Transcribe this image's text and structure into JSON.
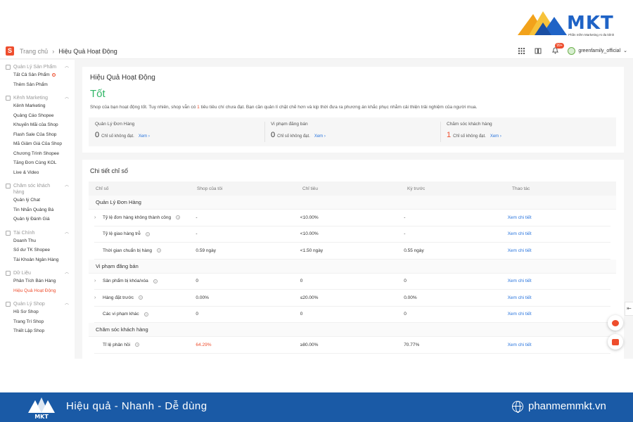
{
  "brand": {
    "name": "MKT",
    "tagline": "Phần mềm Marketing AI đa kênh"
  },
  "colors": {
    "shopee_orange": "#ee4d2d",
    "good_green": "#30b566",
    "link_blue": "#2673dd",
    "banner_blue": "#1a5aa6"
  },
  "topbar": {
    "breadcrumb_home": "Trang chủ",
    "breadcrumb_current": "Hiệu Quả Hoạt Động",
    "icons": [
      "apps-grid-icon",
      "book-icon",
      "bell-icon"
    ],
    "notification_badge": "99+",
    "username": "greenfamily_official"
  },
  "sidebar": {
    "sections": [
      {
        "title": "Quản Lý Sản Phẩm",
        "icon": "box-icon",
        "items": [
          "Tất Cả Sản Phẩm",
          "Thêm Sản Phẩm"
        ]
      },
      {
        "title": "Kênh Marketing",
        "icon": "tag-icon",
        "items": [
          "Kênh Marketing",
          "Quảng Cáo Shopee",
          "Khuyến Mãi của Shop",
          "Flash Sale Của Shop",
          "Mã Giảm Giá Của Shop",
          "Chương Trình Shopee",
          "Tăng Đơn Cùng KOL",
          "Live & Video"
        ]
      },
      {
        "title": "Chăm sóc khách hàng",
        "icon": "chat-icon",
        "items": [
          "Quản lý Chat",
          "Tin Nhắn Quảng Bá",
          "Quản lý Đánh Giá"
        ]
      },
      {
        "title": "Tài Chính",
        "icon": "wallet-icon",
        "items": [
          "Doanh Thu",
          "Số dư TK Shopee",
          "Tài Khoản Ngân Hàng"
        ]
      },
      {
        "title": "Dữ Liệu",
        "icon": "chart-icon",
        "items": [
          "Phân Tích Bán Hàng",
          "Hiệu Quả Hoạt Động"
        ]
      },
      {
        "title": "Quản Lý Shop",
        "icon": "shop-icon",
        "items": [
          "Hồ Sơ Shop",
          "Trang Trí Shop",
          "Thiết Lập Shop"
        ]
      }
    ]
  },
  "overview": {
    "title": "Hiệu Quả Hoạt Động",
    "status": "Tốt",
    "desc_before": "Shop của bạn hoạt động tốt. Tuy nhiên, shop vẫn có ",
    "desc_count": "1",
    "desc_after": " tiêu tiêu chí chưa đạt. Bạn cần quản lí chặt chẽ hơn và kịp thời đưa ra phương án khắc phục nhằm cải thiện trải nghiệm của người mua.",
    "cards": [
      {
        "title": "Quản Lý Đơn Hàng",
        "count": "0",
        "label": "Chỉ số không đạt.",
        "link": "Xem"
      },
      {
        "title": "Vi phạm đăng bán",
        "count": "0",
        "label": "Chỉ số không đạt.",
        "link": "Xem"
      },
      {
        "title": "Chăm sóc khách hàng",
        "count": "1",
        "label": "Chỉ số không đạt.",
        "link": "Xem"
      }
    ]
  },
  "detail": {
    "title": "Chi tiết chỉ số",
    "headers": [
      "Chỉ số",
      "Shop của tôi",
      "Chỉ tiêu",
      "Kỳ trước",
      "Thao tác"
    ],
    "groups": [
      {
        "name": "Quản Lý Đơn Hàng",
        "rows": [
          {
            "name": "Tỷ lệ đơn hàng không thành công",
            "mine": "-",
            "target": "<10.00%",
            "prev": "-",
            "action": "Xem chi tiết"
          },
          {
            "name": "Tỷ lệ giao hàng trễ",
            "mine": "-",
            "target": "<10.00%",
            "prev": "-",
            "action": "Xem chi tiết"
          },
          {
            "name": "Thời gian chuẩn bị hàng",
            "mine": "0.59 ngày",
            "target": "<1.50 ngày",
            "prev": "0.55 ngày",
            "action": "Xem chi tiết"
          }
        ]
      },
      {
        "name": "Vi phạm đăng bán",
        "rows": [
          {
            "name": "Sản phẩm bị khóa/xóa",
            "mine": "0",
            "target": "0",
            "prev": "0",
            "action": "Xem chi tiết"
          },
          {
            "name": "Hàng đặt trước",
            "mine": "0.00%",
            "target": "≤20.00%",
            "prev": "0.00%",
            "action": "Xem chi tiết"
          },
          {
            "name": "Các vi phạm khác",
            "mine": "0",
            "target": "0",
            "prev": "0",
            "action": "Xem chi tiết"
          }
        ]
      },
      {
        "name": "Chăm sóc khách hàng",
        "rows": [
          {
            "name": "Tỉ lệ phản hồi",
            "mine": "64.29%",
            "target": "≥80.00%",
            "prev": "70.77%",
            "action": "Xem chi tiết"
          }
        ]
      }
    ]
  },
  "footer": {
    "slogan": "Hiệu quả - Nhanh - Dễ dùng",
    "website": "phanmemmkt.vn",
    "logo_text": "MKT"
  }
}
